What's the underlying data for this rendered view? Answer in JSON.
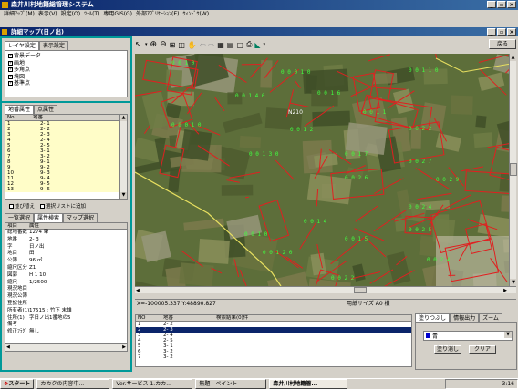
{
  "app": {
    "title": "森井川村地籍総管理システム",
    "window_buttons": [
      "_",
      "▫",
      "×"
    ]
  },
  "menubar": [
    "詳細ﾏｯﾌﾟ(M)",
    "表示(V)",
    "設定(O)",
    "ﾂｰﾙ(T)",
    "専用GIS(G)",
    "外部ｱﾌﾟﾘｹｰｼｮﾝ(E)",
    "ｳｨﾝﾄﾞｳ(W)"
  ],
  "subwindow": {
    "title": "詳細マップ(日ノ出)",
    "window_buttons": [
      "_",
      "▫",
      "×"
    ],
    "back_label": "戻る"
  },
  "layer_tabs": [
    "レイヤ設定",
    "表示設定"
  ],
  "layers": [
    {
      "label": "背景データ",
      "checked": true
    },
    {
      "label": "画地",
      "checked": true
    },
    {
      "label": "多角点",
      "checked": true
    },
    {
      "label": "境図",
      "checked": true
    },
    {
      "label": "基準点",
      "checked": true
    }
  ],
  "lot_tabs": [
    "地番属性",
    "点属性"
  ],
  "lot_list": {
    "headers": [
      "No",
      "地番"
    ],
    "rows": [
      {
        "no": "1",
        "lot": "2- 1"
      },
      {
        "no": "2",
        "lot": "2- 2"
      },
      {
        "no": "3",
        "lot": "2- 3"
      },
      {
        "no": "4",
        "lot": "2- 4"
      },
      {
        "no": "5",
        "lot": "2- 5"
      },
      {
        "no": "6",
        "lot": "3- 1"
      },
      {
        "no": "7",
        "lot": "3- 2"
      },
      {
        "no": "8",
        "lot": "9- 1"
      },
      {
        "no": "9",
        "lot": "9- 2"
      },
      {
        "no": "10",
        "lot": "9- 3"
      },
      {
        "no": "11",
        "lot": "9- 4"
      },
      {
        "no": "12",
        "lot": "9- 5"
      },
      {
        "no": "13",
        "lot": "9- 6"
      }
    ]
  },
  "list_options": [
    "並び替え",
    "選択リストに追加"
  ],
  "search_tabs": [
    "一覧選択",
    "属性検索",
    "マップ選択"
  ],
  "attributes": {
    "headers": [
      "項目",
      "属性"
    ],
    "rows": [
      {
        "k": "総地番数",
        "v": "1274 筆"
      },
      {
        "k": "地番",
        "v": "2- 3"
      },
      {
        "k": "字",
        "v": "日ノ出"
      },
      {
        "k": "地目",
        "v": "田"
      },
      {
        "k": "公簿",
        "v": "96 ㎡"
      },
      {
        "k": "縮尺区分",
        "v": "Z1"
      },
      {
        "k": "図郭",
        "v": "H 1 10"
      },
      {
        "k": "縮尺",
        "v": "1/2500"
      },
      {
        "k": "現況地目",
        "v": ""
      },
      {
        "k": "現況公簿",
        "v": ""
      },
      {
        "k": "登記住所",
        "v": ""
      },
      {
        "k": "所有者(1)",
        "v": "17515 : 竹下 末雄"
      },
      {
        "k": "住所(1)",
        "v": "字日ノ出1番地の5"
      },
      {
        "k": "備考",
        "v": ""
      },
      {
        "k": "修正ﾌﾗｸﾞ",
        "v": "無し"
      }
    ]
  },
  "map": {
    "label_main": "N210",
    "labels": [
      "0 0 1 0",
      "0 0 0 1 0",
      "0 0 1 1 0",
      "0 0 1 6",
      "0 0 1 4 0",
      "0 0 1 1",
      "0 0 0 1 0",
      "0 0 1 2",
      "0 0 2 2",
      "0 0 1 7",
      "0 0 1 3 0",
      "0 0 2 7",
      "0 0 2 9",
      "0 0 2 6",
      "0 0 2 4",
      "0 0 1 4",
      "0 0 1 5",
      "0 0 2 5",
      "0 0 2 4",
      "0 0 1 0",
      "0 0 1 2 0",
      "0 0 2 2"
    ]
  },
  "map_status": {
    "coords": "X=-100005.337 Y:48890.827",
    "scale": "用紙サイズ A0 横"
  },
  "result_table": {
    "headers": [
      "NO",
      "地番",
      "検索結果(0)件"
    ],
    "rows": [
      {
        "no": "1",
        "lot": "2- 2"
      },
      {
        "no": "2",
        "lot": "2- 3"
      },
      {
        "no": "3",
        "lot": "2- 4"
      },
      {
        "no": "4",
        "lot": "2- 5"
      },
      {
        "no": "5",
        "lot": "3- 1"
      },
      {
        "no": "6",
        "lot": "3- 2"
      },
      {
        "no": "7",
        "lot": "3- 2"
      }
    ],
    "selected_index": 1
  },
  "right_tabs": [
    "塗りつぶし",
    "情報出力",
    "ズーム"
  ],
  "color_select": "青",
  "right_buttons": [
    "塗り消し",
    "クリア"
  ],
  "taskbar": {
    "start": "スタート",
    "tasks": [
      "カカクの内容中...",
      "Ver.サービス 1.カカ...",
      "無題 - ペイント",
      "森井川村地籍管...",
      ""
    ],
    "clock": "3:16"
  }
}
